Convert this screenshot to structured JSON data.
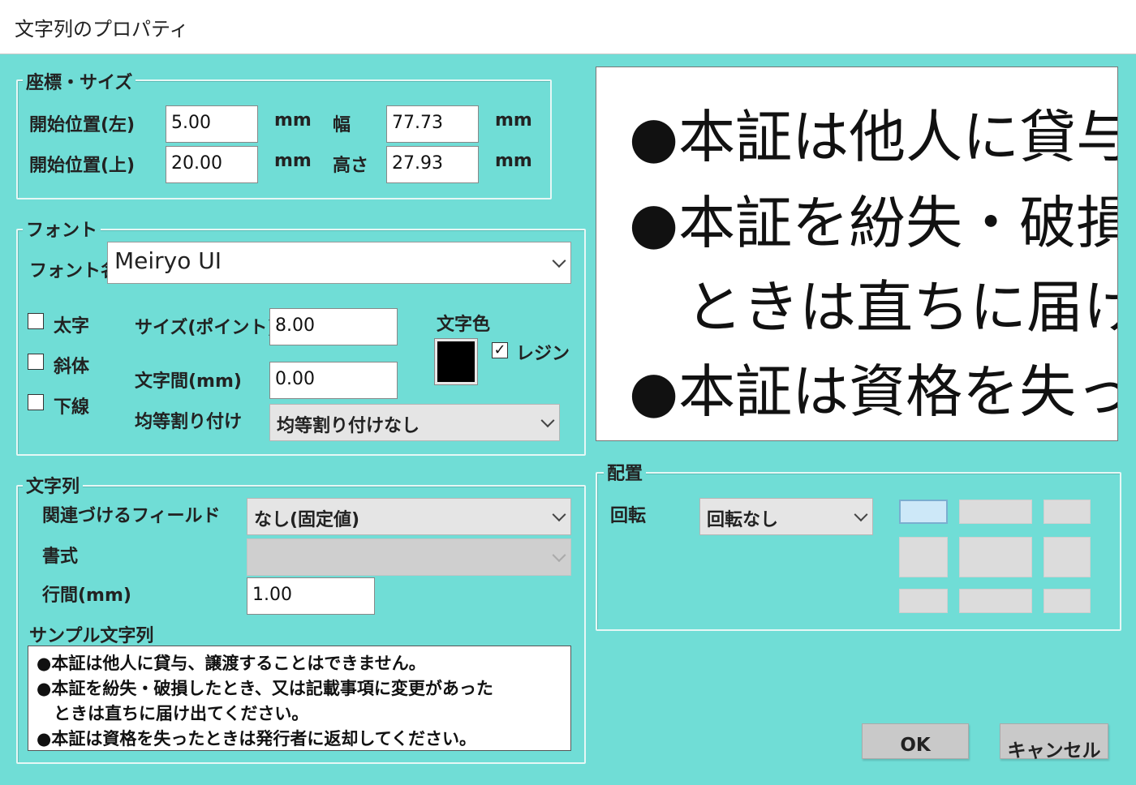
{
  "window": {
    "title": "文字列のプロパティ"
  },
  "position_size": {
    "legend": "座標・サイズ",
    "start_left_label": "開始位置(左)",
    "start_left_value": "5.00",
    "start_top_label": "開始位置(上)",
    "start_top_value": "20.00",
    "unit": "mm",
    "width_label": "幅",
    "width_value": "77.73",
    "height_label": "高さ",
    "height_value": "27.93"
  },
  "font": {
    "legend": "フォント",
    "name_label": "フォント名",
    "name_value": "Meiryo UI",
    "bold_label": "太字",
    "italic_label": "斜体",
    "underline_label": "下線",
    "size_label": "サイズ(ポイント)",
    "size_value": "8.00",
    "spacing_label": "文字間(mm)",
    "spacing_value": "0.00",
    "justify_label": "均等割り付け",
    "justify_value": "均等割り付けなし",
    "color_label": "文字色",
    "color_value": "#000000",
    "resin_label": "レジン",
    "resin_checked": "✓"
  },
  "string": {
    "legend": "文字列",
    "field_label": "関連づけるフィールド",
    "field_value": "なし(固定値)",
    "format_label": "書式",
    "format_value": "",
    "line_spacing_label": "行間(mm)",
    "line_spacing_value": "1.00",
    "sample_label": "サンプル文字列",
    "sample_lines": [
      "●本証は他人に貸与、譲渡することはできません。",
      "●本証を紛失・破損したとき、又は記載事項に変更があった",
      "　ときは直ちに届け出てください。",
      "●本証は資格を失ったときは発行者に返却してください。"
    ]
  },
  "preview": {
    "lines": [
      "●本証は他人に貸与",
      "●本証を紛失・破損",
      "　ときは直ちに届け出",
      "●本証は資格を失っ"
    ]
  },
  "placement": {
    "legend": "配置",
    "rotation_label": "回転",
    "rotation_value": "回転なし"
  },
  "buttons": {
    "ok": "OK",
    "cancel": "キャンセル"
  }
}
